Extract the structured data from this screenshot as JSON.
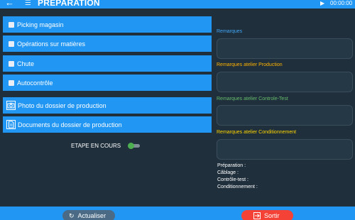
{
  "header": {
    "title": "PREPARATION",
    "timer": "00:00:00",
    "back_icon": "arrow-left-icon",
    "menu_icon": "sliders-icon",
    "play_icon": "play-icon"
  },
  "tasks": [
    {
      "label": "Picking magasin"
    },
    {
      "label": "Opérations sur matières"
    },
    {
      "label": "Chute"
    },
    {
      "label": "Autocontrôle"
    }
  ],
  "documents": [
    {
      "label": "Photo du dossier de production",
      "icon": "camera-icon"
    },
    {
      "label": "Documents du dossier de production",
      "icon": "document-icon"
    }
  ],
  "etape": {
    "label": "ETAPE EN COURS",
    "toggle_on": true
  },
  "remarks": [
    {
      "label": "Remarques",
      "color": "#42a5f5"
    },
    {
      "label": "Remarques atelier Production",
      "color": "#ffb300"
    },
    {
      "label": "Remarques atelier Controle-Test",
      "color": "#66bb6a"
    },
    {
      "label": "Remarques atelier Conditionnement",
      "color": "#ffd600"
    }
  ],
  "status": {
    "preparation": "Préparation :",
    "cablage": "Câblage :",
    "controle": "Contrôle-test :",
    "conditionnement": "Conditionnement :"
  },
  "footer": {
    "refresh_label": "Actualiser",
    "exit_label": "Sortir"
  },
  "colors": {
    "primary": "#2196f3",
    "background": "#1f2f3c",
    "danger": "#f44336",
    "secondary_button": "#4a6a85"
  }
}
